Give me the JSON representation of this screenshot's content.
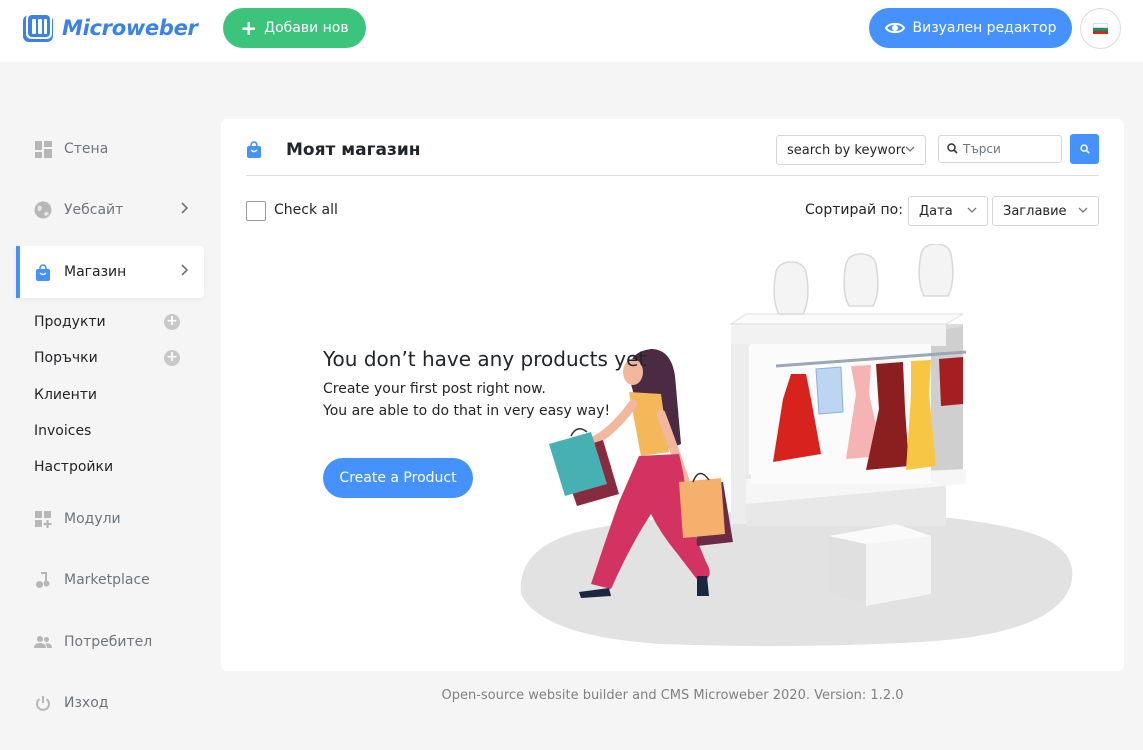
{
  "app": {
    "brand": "Microweber",
    "brand_color": "#3a82e6"
  },
  "header": {
    "add_new_label": "Добави нов",
    "visual_editor_label": "Визуален редактор",
    "language_flag": "bg-flag-icon"
  },
  "sidebar": {
    "items": [
      {
        "label": "Стена",
        "icon": "dashboard-icon"
      },
      {
        "label": "Уебсайт",
        "icon": "globe-icon"
      },
      {
        "label": "Магазин",
        "icon": "shop-bag-icon",
        "active": true
      },
      {
        "label": "Модули",
        "icon": "modules-icon"
      },
      {
        "label": "Marketplace",
        "icon": "marketplace-icon"
      },
      {
        "label": "Потребител",
        "icon": "users-icon"
      },
      {
        "label": "Изход",
        "icon": "power-icon"
      }
    ],
    "shop_subitems": [
      {
        "label": "Продукти",
        "has_add": true
      },
      {
        "label": "Поръчки",
        "has_add": true
      },
      {
        "label": "Клиенти"
      },
      {
        "label": "Invoices"
      },
      {
        "label": "Настройки"
      }
    ]
  },
  "main": {
    "title": "Моят магазин",
    "search_select_value": "search by keyword",
    "search_placeholder": "Търси",
    "check_all_label": "Check all",
    "sort_label": "Сортирай по:",
    "sort_options": [
      "Дата",
      "Заглавие"
    ],
    "empty_state": {
      "title": "You don’t have any products yet",
      "line1": "Create your first post right now.",
      "line2": "You are able to do that in very easy way!",
      "button_label": "Create a Product"
    }
  },
  "footer": {
    "text": "Open-source website builder and CMS Microweber 2020. Version: 1.2.0"
  },
  "colors": {
    "primary": "#4592ff",
    "success": "#3cc47c",
    "background": "#f5f5f6"
  }
}
